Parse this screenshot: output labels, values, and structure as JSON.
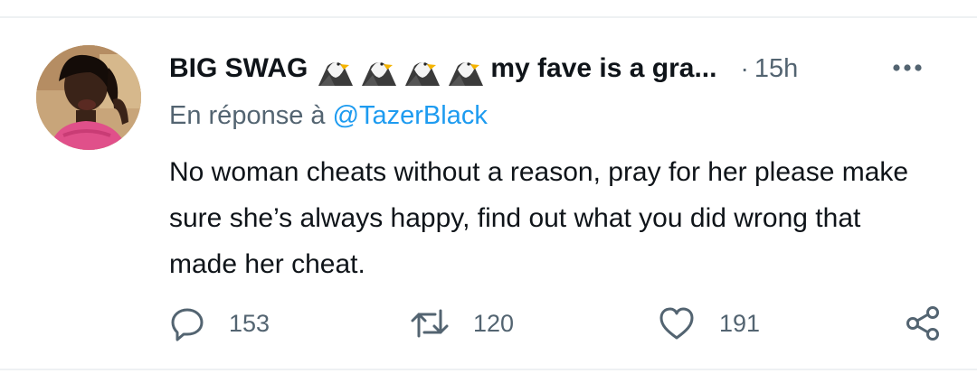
{
  "tweet": {
    "display_name": "BIG SWAG",
    "name_suffix": "my fave is a gra...",
    "name_emojis": [
      "eagle-emoji",
      "eagle-emoji",
      "eagle-emoji",
      "eagle-emoji"
    ],
    "separator": "·",
    "timestamp": "15h",
    "reply_prefix": "En réponse à",
    "reply_handle": "@TazerBlack",
    "text": "No woman cheats without a reason, pray for her please make sure she’s always happy, find out what you did wrong that made her cheat."
  },
  "actions": {
    "reply": {
      "icon": "comment-icon",
      "count": "153"
    },
    "retweet": {
      "icon": "retweet-icon",
      "count": "120"
    },
    "like": {
      "icon": "heart-icon",
      "count": "191"
    },
    "share": {
      "icon": "share-icon"
    }
  },
  "colors": {
    "text": "#0f1419",
    "secondary": "#536471",
    "link": "#1d9bf0",
    "divider": "#eef1f3"
  }
}
